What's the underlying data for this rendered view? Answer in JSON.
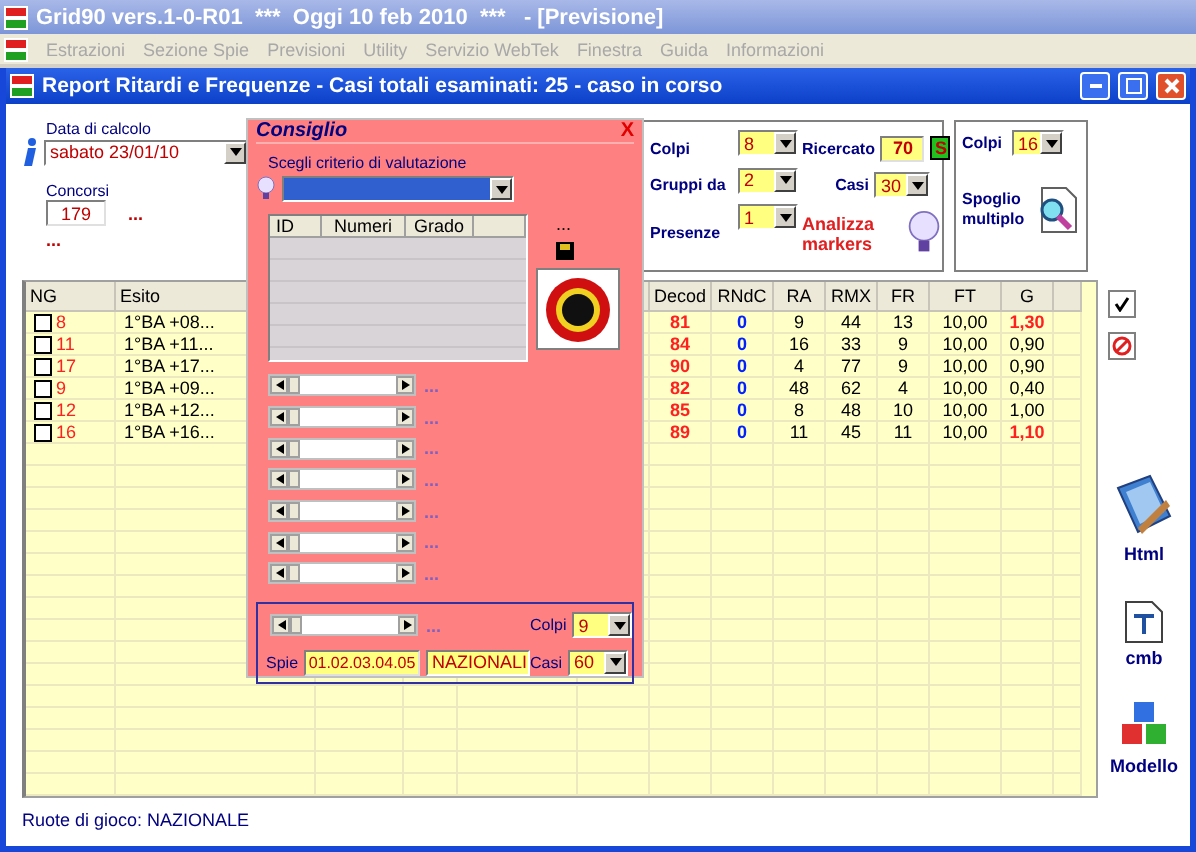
{
  "app": {
    "title": "Grid90 vers.1-0-R01  ***  Oggi 10 feb 2010  ***   - [Previsione]"
  },
  "menu": [
    {
      "label": "Estrazioni",
      "disabled": true
    },
    {
      "label": "Sezione Spie",
      "disabled": true
    },
    {
      "label": "Previsioni",
      "disabled": true
    },
    {
      "label": "Utility",
      "disabled": true
    },
    {
      "label": "Servizio WebTek",
      "disabled": true
    },
    {
      "label": "Finestra",
      "disabled": true
    },
    {
      "label": "Guida",
      "disabled": true
    },
    {
      "label": "Informazioni",
      "disabled": true
    }
  ],
  "window": {
    "title": "Report Ritardi e Frequenze - Casi totali esaminati: 25 - caso in corso"
  },
  "date": {
    "label": "Data di calcolo",
    "value": "sabato 23/01/10"
  },
  "concorsi": {
    "label": "Concorsi",
    "value": "179",
    "more": "...",
    "more_below": "..."
  },
  "markers": {
    "colpi": {
      "label": "Colpi",
      "value": "8"
    },
    "gruppi": {
      "label": "Gruppi da",
      "value": "2"
    },
    "presenze": {
      "label": "Presenze",
      "value": "1"
    },
    "ricercato": {
      "label": "Ricercato",
      "value": "70",
      "badge": "S"
    },
    "casi": {
      "label": "Casi",
      "value": "30"
    },
    "action": "Analizza markers"
  },
  "spoglio": {
    "colpi": {
      "label": "Colpi",
      "value": "16"
    },
    "action": "Spoglio multiplo"
  },
  "table": {
    "columns": [
      "NG",
      "Esito",
      "Decod",
      "RNdC",
      "RA",
      "RMX",
      "FR",
      "FT",
      "G"
    ],
    "rows": [
      {
        "checked": false,
        "highlight": true,
        "cells": [
          "8",
          "1°BA +08...",
          "81",
          "0",
          "9",
          "44",
          "13",
          "10,00",
          "1,30"
        ]
      },
      {
        "checked": false,
        "highlight": false,
        "cells": [
          "11",
          "1°BA +11...",
          "84",
          "0",
          "16",
          "33",
          "9",
          "10,00",
          "0,90"
        ]
      },
      {
        "checked": false,
        "highlight": false,
        "cells": [
          "17",
          "1°BA +17...",
          "90",
          "0",
          "4",
          "77",
          "9",
          "10,00",
          "0,90"
        ]
      },
      {
        "checked": false,
        "highlight": false,
        "cells": [
          "9",
          "1°BA +09...",
          "82",
          "0",
          "48",
          "62",
          "4",
          "10,00",
          "0,40"
        ]
      },
      {
        "checked": false,
        "highlight": false,
        "cells": [
          "12",
          "1°BA +12...",
          "85",
          "0",
          "8",
          "48",
          "10",
          "10,00",
          "1,00"
        ]
      },
      {
        "checked": false,
        "highlight": true,
        "cells": [
          "16",
          "1°BA +16...",
          "89",
          "0",
          "11",
          "45",
          "11",
          "10,00",
          "1,10"
        ]
      }
    ]
  },
  "status": "Ruote di gioco: NAZIONALE",
  "tools": [
    {
      "kind": "html",
      "label": "Html"
    },
    {
      "kind": "cmb",
      "label": "cmb"
    },
    {
      "kind": "model",
      "label": "Modello"
    }
  ],
  "dialog": {
    "title": "Consiglio",
    "close": "X",
    "criterion_label": "Scegli criterio di valutazione",
    "grid_columns": [
      "ID",
      "Numeri",
      "Grado"
    ],
    "more": "...",
    "sliders": [
      {
        "value": "..."
      },
      {
        "value": "..."
      },
      {
        "value": "..."
      },
      {
        "value": "..."
      },
      {
        "value": "..."
      },
      {
        "value": "..."
      },
      {
        "value": "..."
      }
    ],
    "bottom": {
      "slider": {
        "value": "..."
      },
      "colpi": {
        "label": "Colpi",
        "value": "9"
      },
      "spie": {
        "label": "Spie",
        "value": "01.02.03.04.05"
      },
      "ruota": "NAZIONALI",
      "casi": {
        "label": "Casi",
        "value": "60"
      }
    }
  }
}
